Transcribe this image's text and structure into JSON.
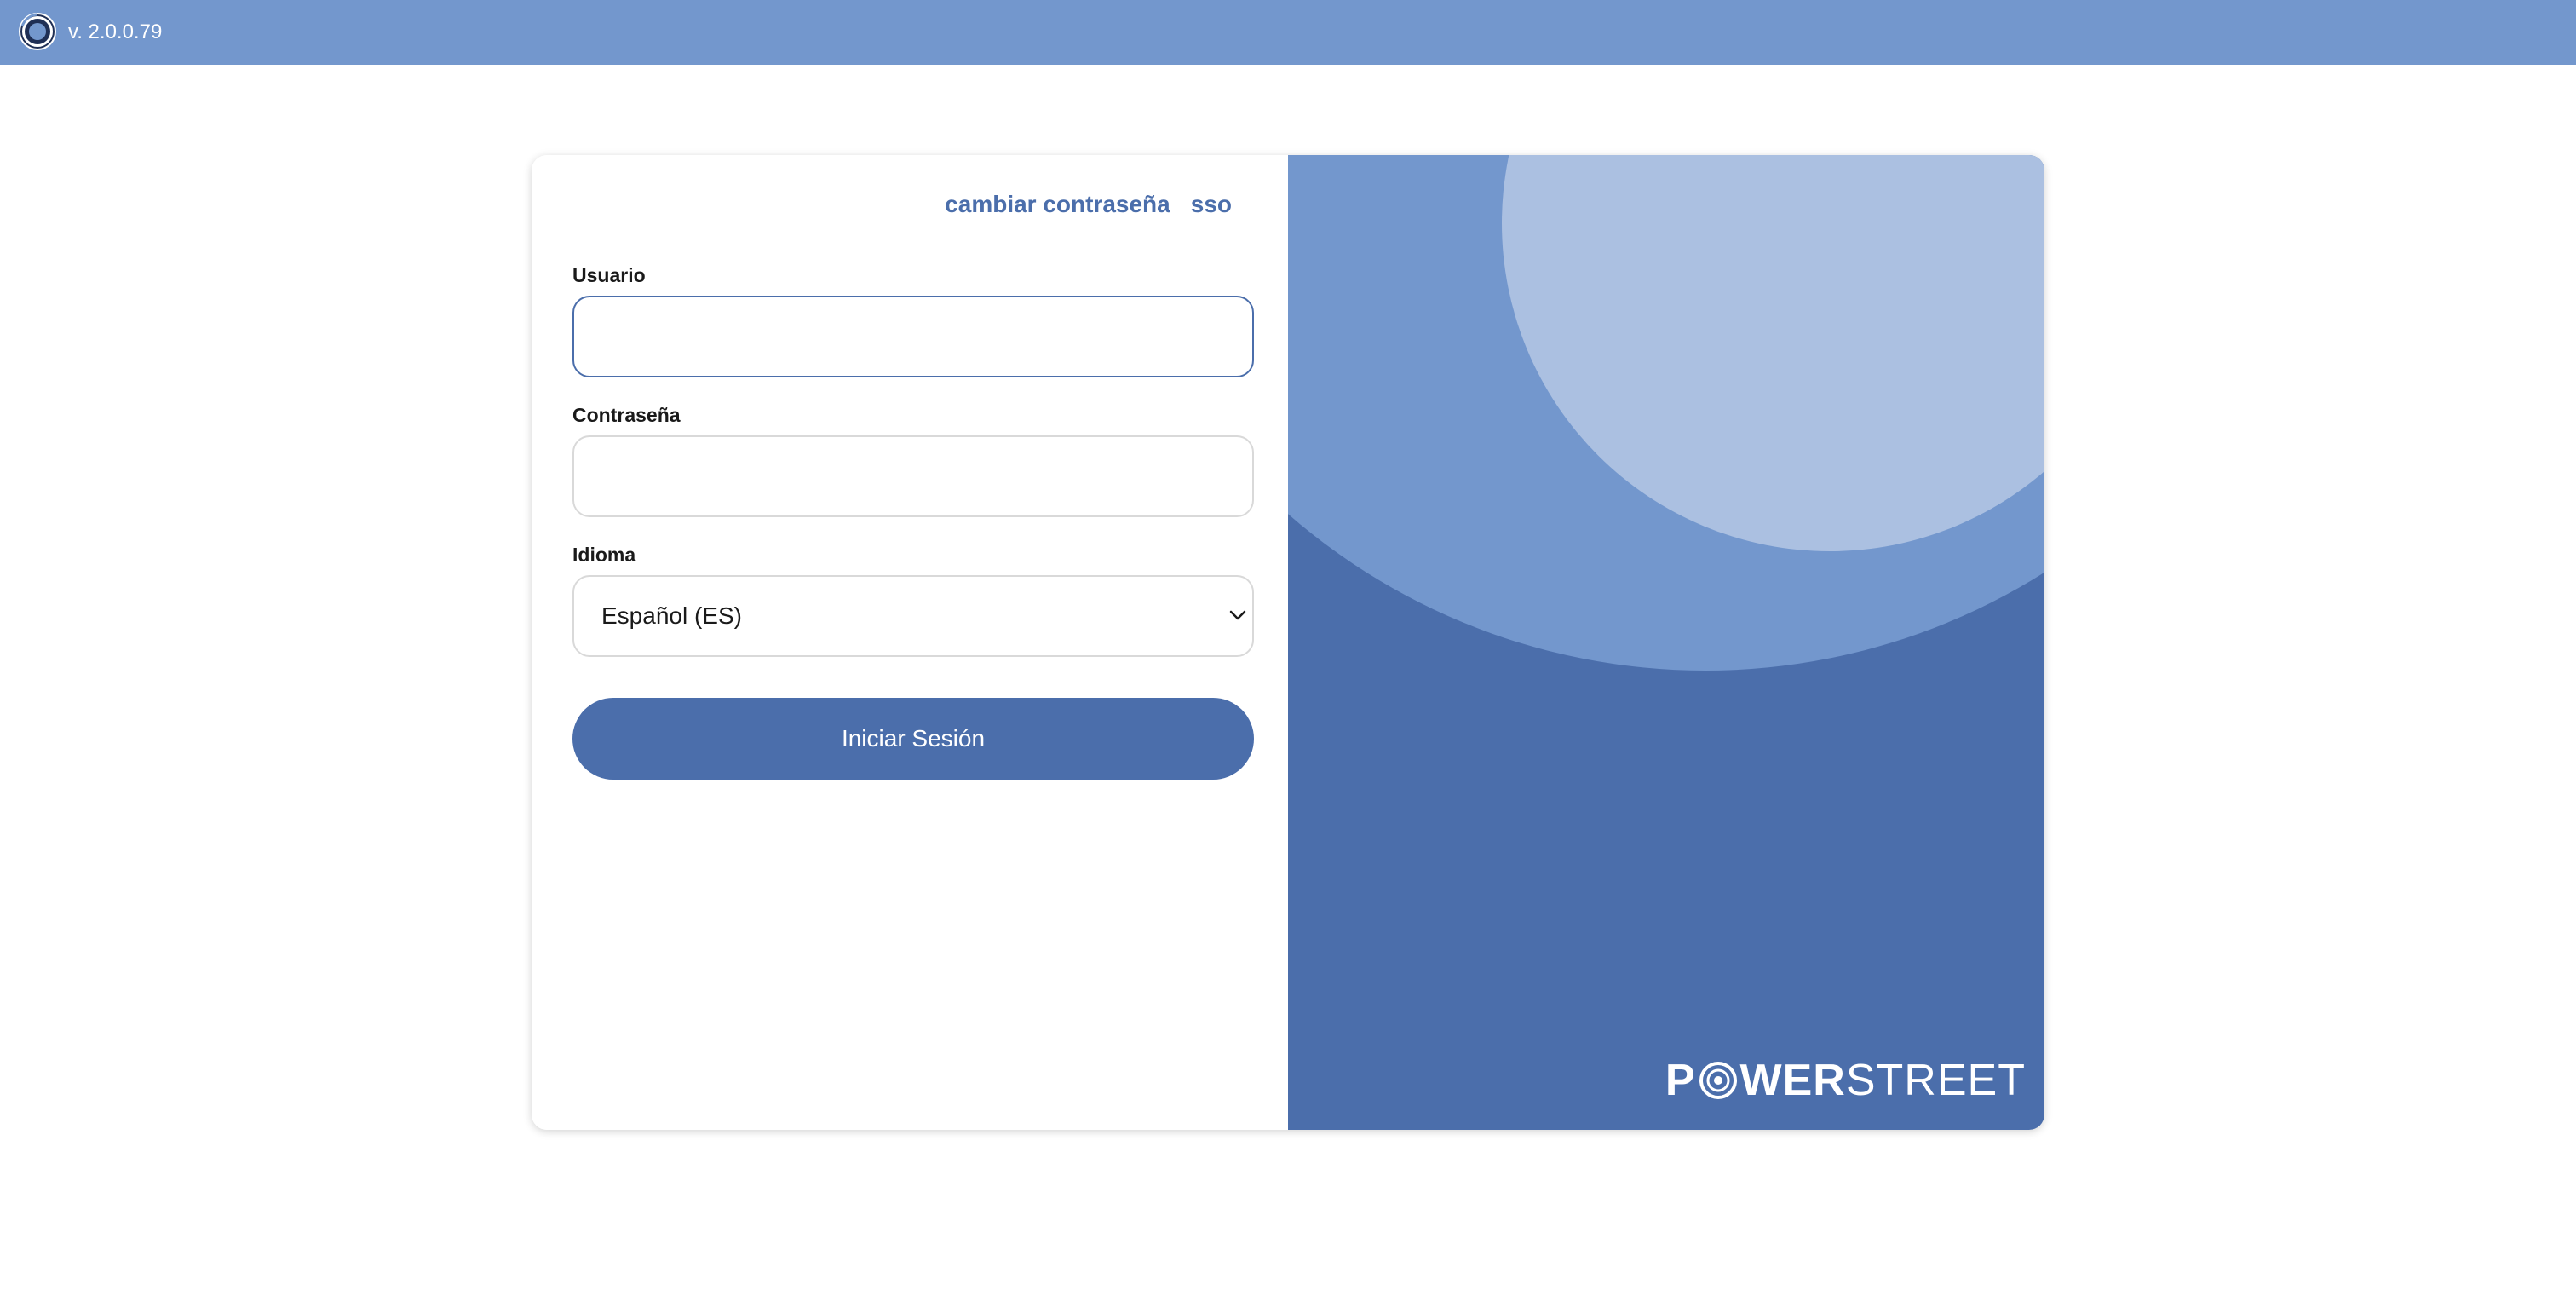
{
  "app": {
    "version": "v. 2.0.0.79",
    "logo_icon": "app-logo-icon"
  },
  "login": {
    "links": {
      "change_password": "cambiar contraseña",
      "sso": "sso"
    },
    "username": {
      "label": "Usuario",
      "value": ""
    },
    "password": {
      "label": "Contraseña",
      "value": ""
    },
    "language": {
      "label": "Idioma",
      "selected": "Español (ES)",
      "icon": "chevron-down-icon"
    },
    "submit_label": "Iniciar Sesión"
  },
  "brand": {
    "name_bold_pre": "P",
    "name_bold_post": "WER",
    "name_light": "STREET"
  },
  "colors": {
    "header": "#7397cd",
    "accent": "#4b6eab",
    "circle_mid": "#7397cd",
    "circle_light": "#abc0e1"
  }
}
